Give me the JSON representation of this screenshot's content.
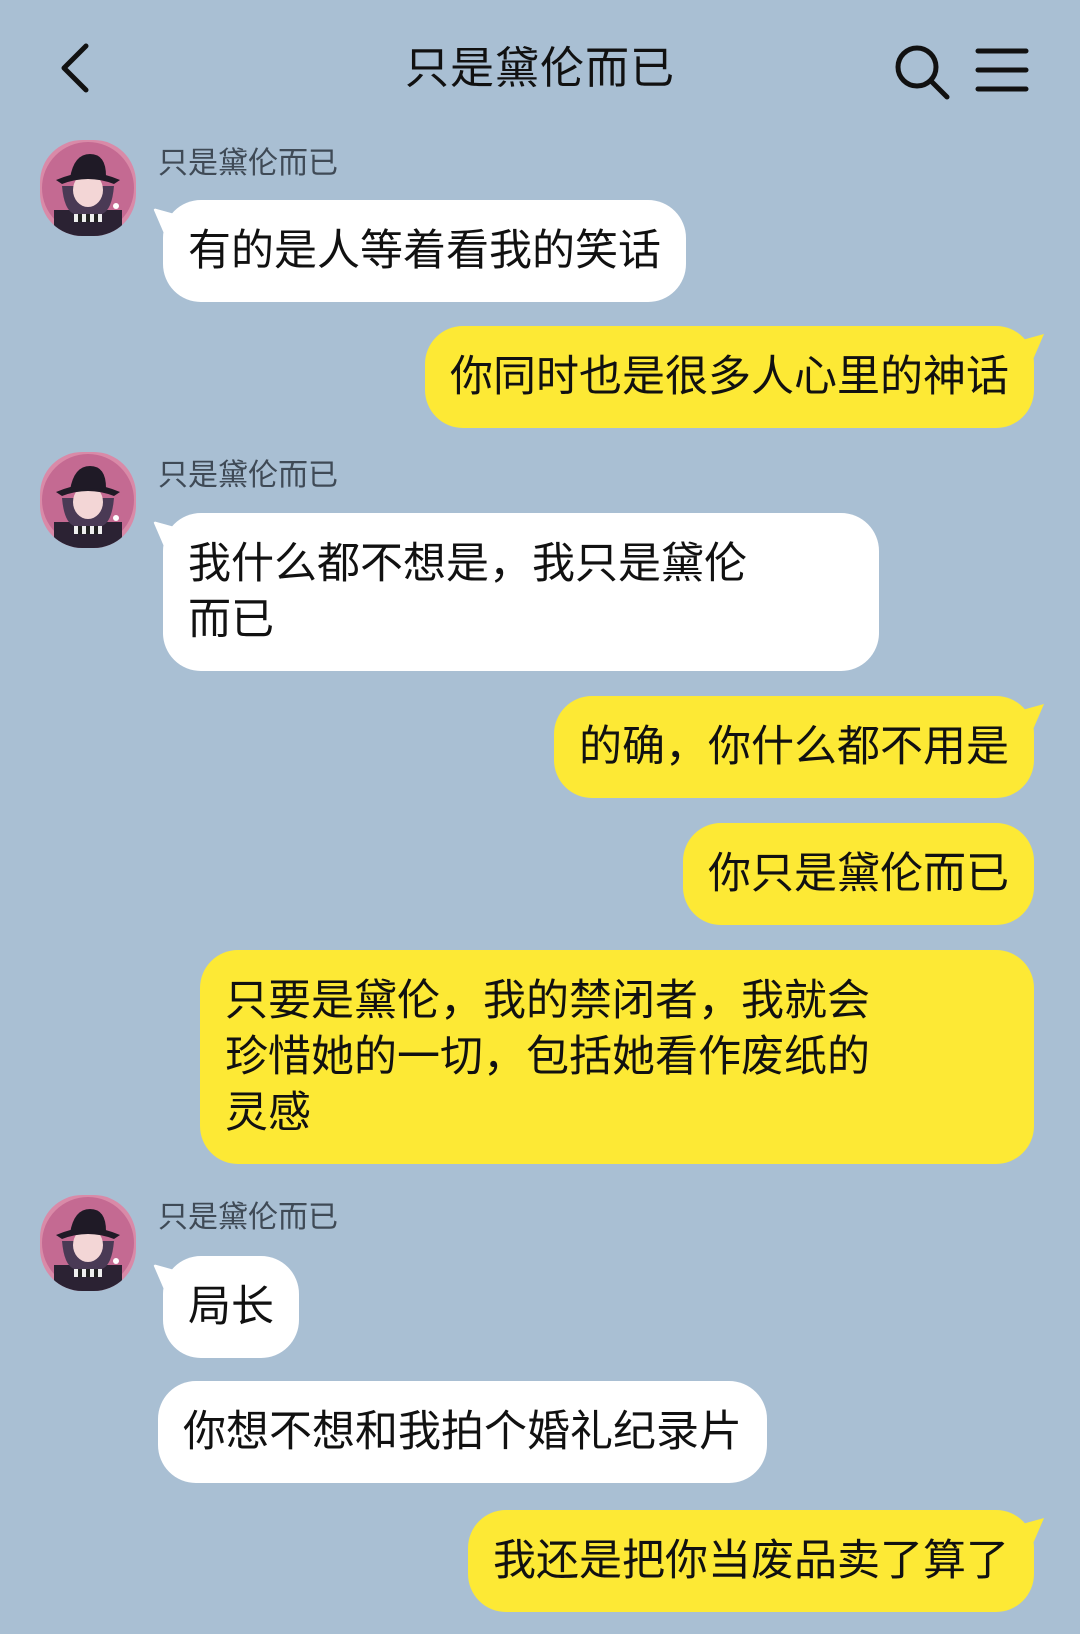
{
  "header": {
    "title": "只是黛伦而已"
  },
  "contact": {
    "name": "只是黛伦而已"
  },
  "messages": {
    "m1": "有的是人等着看我的笑话",
    "m2": "你同时也是很多人心里的神话",
    "m3_line1": "我什么都不想是，我只是黛伦",
    "m3_line2": "而已",
    "m4": "的确，你什么都不用是",
    "m5": "你只是黛伦而已",
    "m6_line1": "只要是黛伦，我的禁闭者，我就会",
    "m6_line2": "珍惜她的一切，包括她看作废纸的",
    "m6_line3": "灵感",
    "m7": "局长",
    "m8": "你想不想和我拍个婚礼纪录片",
    "m9": "我还是把你当废品卖了算了"
  },
  "colors": {
    "background": "#a9bfd3",
    "incoming_bubble": "#ffffff",
    "outgoing_bubble": "#fde935"
  },
  "icons": {
    "back": "chevron-left-icon",
    "search": "search-icon",
    "menu": "menu-icon"
  }
}
